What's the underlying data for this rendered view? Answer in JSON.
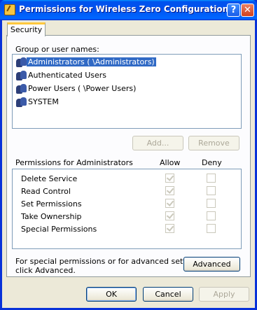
{
  "window": {
    "title": "Permissions for Wireless Zero Configuration",
    "help_button": "?",
    "close_button": "✕"
  },
  "tabs": [
    {
      "label": "Security"
    }
  ],
  "group_list": {
    "label": "Group or user names:",
    "items": [
      {
        "text": "Administrators (           \\Administrators)",
        "selected": true
      },
      {
        "text": "Authenticated Users",
        "selected": false
      },
      {
        "text": "Power Users (           \\Power Users)",
        "selected": false
      },
      {
        "text": "SYSTEM",
        "selected": false
      }
    ]
  },
  "group_buttons": {
    "add": "Add...",
    "remove": "Remove"
  },
  "permissions": {
    "label": "Permissions for Administrators",
    "allow_header": "Allow",
    "deny_header": "Deny",
    "rows": [
      {
        "name": "Delete Service",
        "allow": true,
        "deny": false
      },
      {
        "name": "Read Control",
        "allow": true,
        "deny": false
      },
      {
        "name": "Set Permissions",
        "allow": true,
        "deny": false
      },
      {
        "name": "Take Ownership",
        "allow": true,
        "deny": false
      },
      {
        "name": "Special Permissions",
        "allow": true,
        "deny": false
      }
    ]
  },
  "advanced": {
    "hint_line1": "For special permissions or for advanced settings,",
    "hint_line2": "click Advanced.",
    "button": "Advanced"
  },
  "footer": {
    "ok": "OK",
    "cancel": "Cancel",
    "apply": "Apply"
  }
}
